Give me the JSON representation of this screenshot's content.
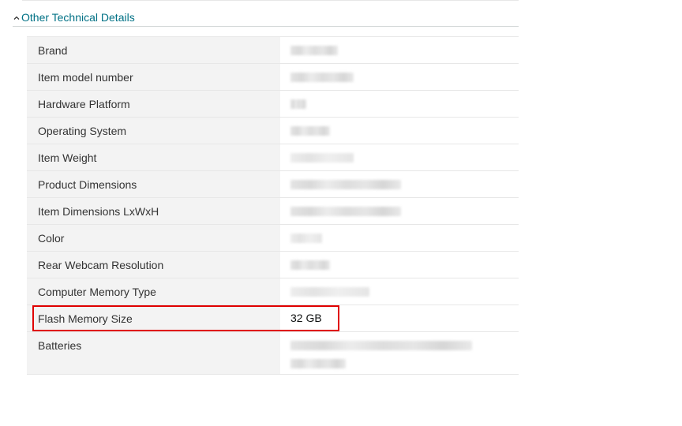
{
  "section": {
    "title": "Other Technical Details",
    "collapse_icon": "chevron-up-icon"
  },
  "rows": [
    {
      "label": "Brand",
      "value": "",
      "redacted": true
    },
    {
      "label": "Item model number",
      "value": "",
      "redacted": true
    },
    {
      "label": "Hardware Platform",
      "value": "",
      "redacted": true
    },
    {
      "label": "Operating System",
      "value": "",
      "redacted": true
    },
    {
      "label": "Item Weight",
      "value": "",
      "redacted": true
    },
    {
      "label": "Product Dimensions",
      "value": "",
      "redacted": true
    },
    {
      "label": "Item Dimensions LxWxH",
      "value": "",
      "redacted": true
    },
    {
      "label": "Color",
      "value": "",
      "redacted": true
    },
    {
      "label": "Rear Webcam Resolution",
      "value": "",
      "redacted": true
    },
    {
      "label": "Computer Memory Type",
      "value": "",
      "redacted": true
    },
    {
      "label": "Flash Memory Size",
      "value": "32 GB",
      "redacted": false,
      "highlighted": true
    },
    {
      "label": "Batteries",
      "value": "",
      "redacted": true
    }
  ],
  "colors": {
    "link": "#007185",
    "label_bg": "#f3f3f3",
    "highlight": "#e00000"
  }
}
